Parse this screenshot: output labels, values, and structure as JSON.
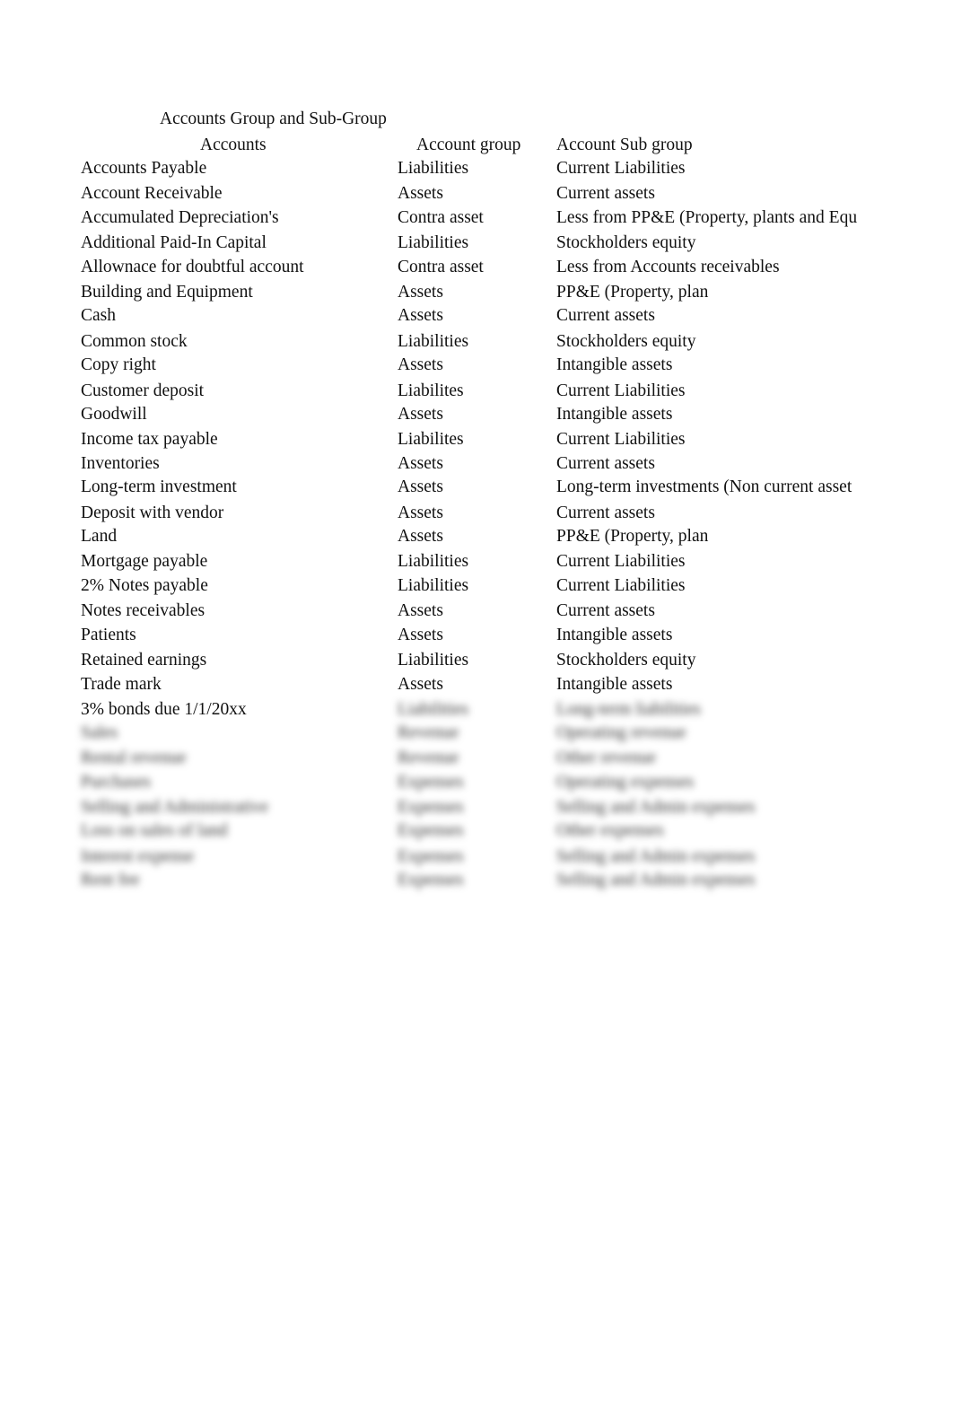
{
  "document": {
    "title": "Accounts Group and Sub-Group",
    "headers": {
      "account": "Accounts",
      "group": "Account group",
      "subgroup": "Account Sub group"
    },
    "rows": [
      {
        "account": "Accounts Payable",
        "group": "Liabilities",
        "subgroup": "Current Liabilities",
        "obscured": false
      },
      {
        "account": "Account Receivable",
        "group": "Assets",
        "subgroup": "Current assets",
        "obscured": false
      },
      {
        "account": "Accumulated Depreciation's",
        "group": "Contra asset",
        "subgroup": "Less from PP&E (Property, plants and Equ",
        "obscured": false
      },
      {
        "account": "Additional Paid-In Capital",
        "group": "Liabilities",
        "subgroup": "Stockholders equity",
        "obscured": false
      },
      {
        "account": "Allownace for doubtful account",
        "group": "Contra asset",
        "subgroup": "Less from Accounts receivables",
        "obscured": false
      },
      {
        "account": "Building and Equipment",
        "group": "Assets",
        "subgroup": "PP&E (Property, plan",
        "obscured": false
      },
      {
        "account": "Cash",
        "group": "Assets",
        "subgroup": "Current assets",
        "obscured": false
      },
      {
        "account": "Common stock",
        "group": "Liabilities",
        "subgroup": "Stockholders equity",
        "obscured": false
      },
      {
        "account": "Copy right",
        "group": "Assets",
        "subgroup": "Intangible assets",
        "obscured": false
      },
      {
        "account": "Customer deposit",
        "group": "Liabilites",
        "subgroup": "Current Liabilities",
        "obscured": false
      },
      {
        "account": "Goodwill",
        "group": "Assets",
        "subgroup": "Intangible assets",
        "obscured": false
      },
      {
        "account": "Income tax payable",
        "group": "Liabilites",
        "subgroup": "Current Liabilities",
        "obscured": false
      },
      {
        "account": "Inventories",
        "group": "Assets",
        "subgroup": "Current assets",
        "obscured": false
      },
      {
        "account": "Long-term investment",
        "group": "Assets",
        "subgroup": "Long-term investments (Non current asset",
        "obscured": false
      },
      {
        "account": "Deposit with vendor",
        "group": "Assets",
        "subgroup": "Current assets",
        "obscured": false
      },
      {
        "account": "Land",
        "group": "Assets",
        "subgroup": "PP&E (Property, plan",
        "obscured": false
      },
      {
        "account": "Mortgage payable",
        "group": "Liabilities",
        "subgroup": "Current Liabilities",
        "obscured": false
      },
      {
        "account": "2% Notes payable",
        "group": "Liabilities",
        "subgroup": "Current Liabilities",
        "obscured": false
      },
      {
        "account": "Notes receivables",
        "group": "Assets",
        "subgroup": "Current assets",
        "obscured": false
      },
      {
        "account": "Patients",
        "group": "Assets",
        "subgroup": "Intangible assets",
        "obscured": false
      },
      {
        "account": "Retained earnings",
        "group": "Liabilities",
        "subgroup": "Stockholders equity",
        "obscured": false
      },
      {
        "account": "Trade mark",
        "group": "Assets",
        "subgroup": "Intangible assets",
        "obscured": false
      },
      {
        "account": "3% bonds due 1/1/20xx",
        "group": "Liabilities",
        "subgroup": "Long-term liabilities",
        "obscured": "partial"
      },
      {
        "account": "Sales",
        "group": "Revenue",
        "subgroup": "Operating revenue",
        "obscured": true
      },
      {
        "account": "Rental revenue",
        "group": "Revenue",
        "subgroup": "Other revenue",
        "obscured": true
      },
      {
        "account": "Purchases",
        "group": "Expenses",
        "subgroup": "Operating expenses",
        "obscured": true
      },
      {
        "account": "Selling and Administrative",
        "group": "Expenses",
        "subgroup": "Selling and Admin expenses",
        "obscured": true
      },
      {
        "account": "Loss on sales of land",
        "group": "Expenses",
        "subgroup": "Other expenses",
        "obscured": true
      },
      {
        "account": "Interest expense",
        "group": "Expenses",
        "subgroup": "Selling and Admin expenses",
        "obscured": true
      },
      {
        "account": "Rent fee",
        "group": "Expenses",
        "subgroup": "Selling and Admin expenses",
        "obscured": true
      }
    ]
  }
}
